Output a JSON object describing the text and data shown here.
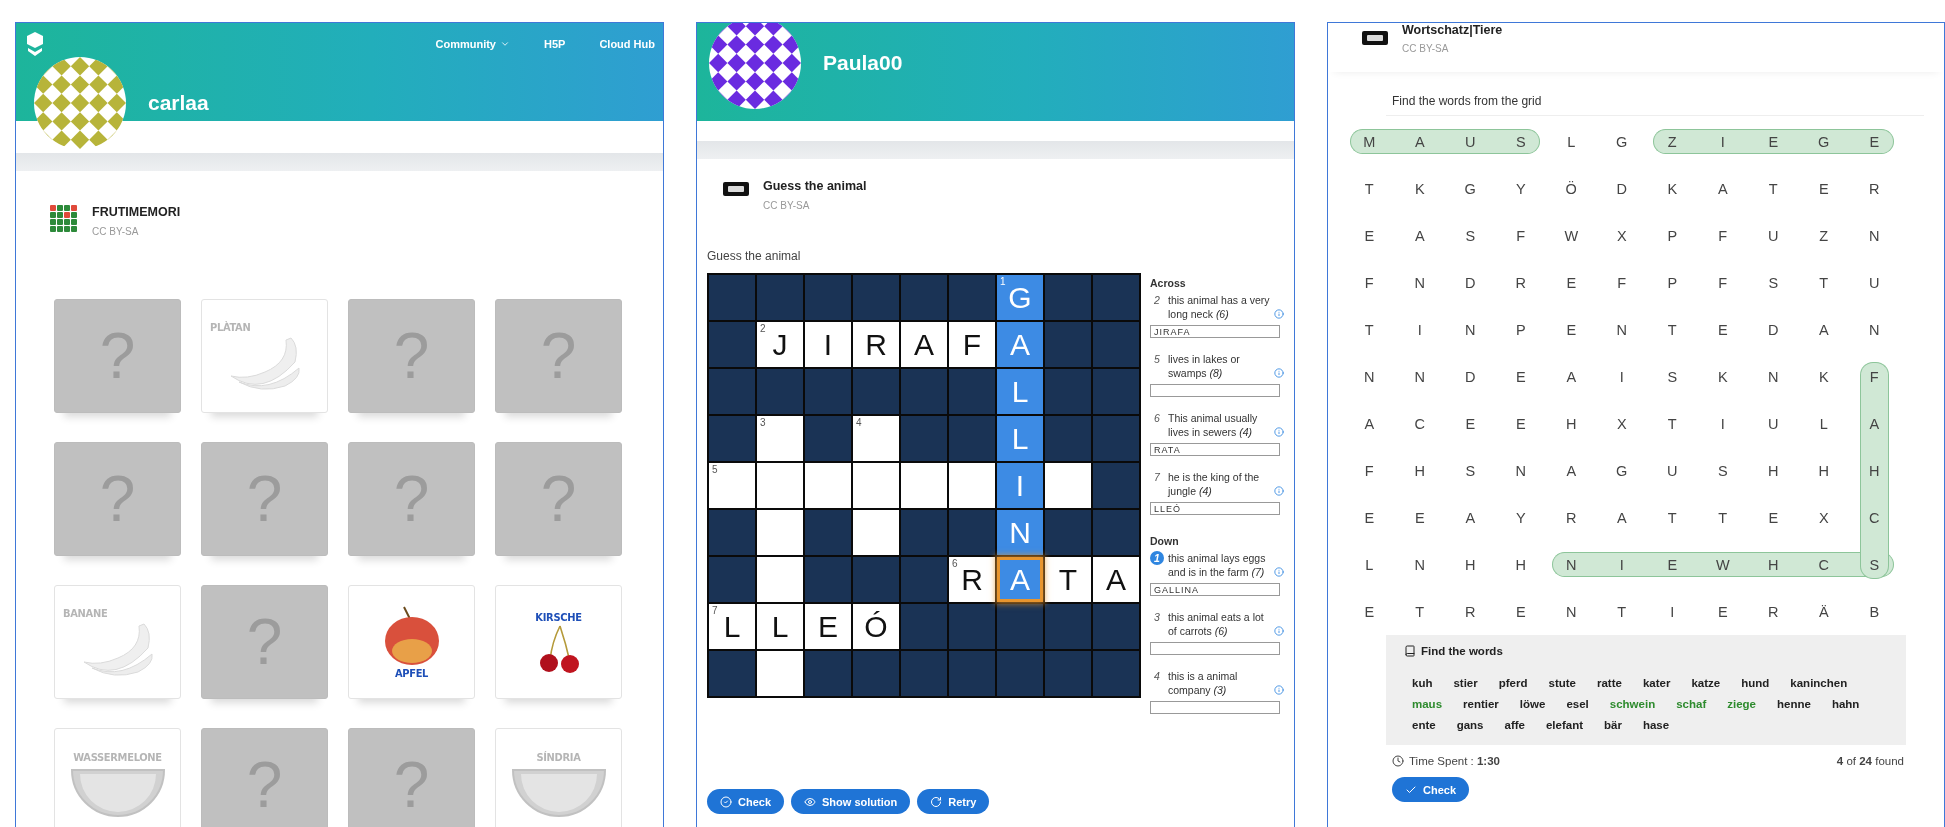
{
  "memory_panel": {
    "nav": [
      {
        "label": "Community",
        "dropdown": true
      },
      {
        "label": "H5P",
        "dropdown": false
      },
      {
        "label": "Cloud Hub",
        "dropdown": false
      }
    ],
    "user": {
      "name": "carlaa"
    },
    "content": {
      "title": "FRUTIMEMORI",
      "license": "CC BY-SA"
    },
    "cards": [
      {
        "kind": "hidden",
        "symbol": "?"
      },
      {
        "kind": "banana",
        "label": "PLÀTAN",
        "matched": true
      },
      {
        "kind": "hidden",
        "symbol": "?"
      },
      {
        "kind": "hidden",
        "symbol": "?"
      },
      {
        "kind": "hidden",
        "symbol": "?"
      },
      {
        "kind": "hidden",
        "symbol": "?"
      },
      {
        "kind": "hidden",
        "symbol": "?"
      },
      {
        "kind": "hidden",
        "symbol": "?"
      },
      {
        "kind": "banana",
        "label": "BANANE",
        "matched": true
      },
      {
        "kind": "hidden",
        "symbol": "?"
      },
      {
        "kind": "apple",
        "label": "APFEL",
        "matched": false
      },
      {
        "kind": "cherry",
        "label": "KIRSCHE",
        "matched": false
      },
      {
        "kind": "melon",
        "label": "WASSERMELONE",
        "matched": true
      },
      {
        "kind": "hidden",
        "symbol": "?"
      },
      {
        "kind": "hidden",
        "symbol": "?"
      },
      {
        "kind": "melon",
        "label": "SÍNDRIA",
        "matched": true
      }
    ]
  },
  "crossword_panel": {
    "user": {
      "name": "Paula00"
    },
    "content": {
      "title": "Guess the animal",
      "license": "CC BY-SA"
    },
    "question": "Guess the animal",
    "grid": [
      {
        "cells": [
          {
            "kind": "block"
          },
          {
            "kind": "block"
          },
          {
            "kind": "block"
          },
          {
            "kind": "block"
          },
          {
            "kind": "block"
          },
          {
            "kind": "block"
          },
          {
            "kind": "open",
            "letter": "G",
            "number": "1",
            "highlighted": true,
            "focused": false
          },
          {
            "kind": "block"
          },
          {
            "kind": "block"
          }
        ]
      },
      {
        "cells": [
          {
            "kind": "block"
          },
          {
            "kind": "open",
            "letter": "J",
            "number": "2",
            "highlighted": false,
            "focused": false
          },
          {
            "kind": "open",
            "letter": "I",
            "highlighted": false,
            "focused": false
          },
          {
            "kind": "open",
            "letter": "R",
            "highlighted": false,
            "focused": false
          },
          {
            "kind": "open",
            "letter": "A",
            "highlighted": false,
            "focused": false
          },
          {
            "kind": "open",
            "letter": "F",
            "highlighted": false,
            "focused": false
          },
          {
            "kind": "open",
            "letter": "A",
            "highlighted": true,
            "focused": false
          },
          {
            "kind": "block"
          },
          {
            "kind": "block"
          }
        ]
      },
      {
        "cells": [
          {
            "kind": "block"
          },
          {
            "kind": "block"
          },
          {
            "kind": "block"
          },
          {
            "kind": "block"
          },
          {
            "kind": "block"
          },
          {
            "kind": "block"
          },
          {
            "kind": "open",
            "letter": "L",
            "highlighted": true,
            "focused": false
          },
          {
            "kind": "block"
          },
          {
            "kind": "block"
          }
        ]
      },
      {
        "cells": [
          {
            "kind": "block"
          },
          {
            "kind": "open",
            "number": "3",
            "highlighted": false,
            "focused": false
          },
          {
            "kind": "block"
          },
          {
            "kind": "open",
            "number": "4",
            "highlighted": false,
            "focused": false
          },
          {
            "kind": "block"
          },
          {
            "kind": "block"
          },
          {
            "kind": "open",
            "letter": "L",
            "highlighted": true,
            "focused": false
          },
          {
            "kind": "block"
          },
          {
            "kind": "block"
          }
        ]
      },
      {
        "cells": [
          {
            "kind": "open",
            "number": "5",
            "highlighted": false,
            "focused": false
          },
          {
            "kind": "open",
            "highlighted": false,
            "focused": false
          },
          {
            "kind": "open",
            "highlighted": false,
            "focused": false
          },
          {
            "kind": "open",
            "highlighted": false,
            "focused": false
          },
          {
            "kind": "open",
            "highlighted": false,
            "focused": false
          },
          {
            "kind": "open",
            "highlighted": false,
            "focused": false
          },
          {
            "kind": "open",
            "letter": "I",
            "highlighted": true,
            "focused": false
          },
          {
            "kind": "open",
            "highlighted": false,
            "focused": false
          },
          {
            "kind": "block"
          }
        ]
      },
      {
        "cells": [
          {
            "kind": "block"
          },
          {
            "kind": "open",
            "highlighted": false,
            "focused": false
          },
          {
            "kind": "block"
          },
          {
            "kind": "open",
            "highlighted": false,
            "focused": false
          },
          {
            "kind": "block"
          },
          {
            "kind": "block"
          },
          {
            "kind": "open",
            "letter": "N",
            "highlighted": true,
            "focused": false
          },
          {
            "kind": "block"
          },
          {
            "kind": "block"
          }
        ]
      },
      {
        "cells": [
          {
            "kind": "block"
          },
          {
            "kind": "open",
            "highlighted": false,
            "focused": false
          },
          {
            "kind": "block"
          },
          {
            "kind": "block"
          },
          {
            "kind": "block"
          },
          {
            "kind": "open",
            "letter": "R",
            "number": "6",
            "highlighted": false,
            "focused": false
          },
          {
            "kind": "open",
            "letter": "A",
            "highlighted": true,
            "focused": true
          },
          {
            "kind": "open",
            "letter": "T",
            "highlighted": false,
            "focused": false
          },
          {
            "kind": "open",
            "letter": "A",
            "highlighted": false,
            "focused": false
          }
        ]
      },
      {
        "cells": [
          {
            "kind": "open",
            "letter": "L",
            "number": "7",
            "highlighted": false,
            "focused": false
          },
          {
            "kind": "open",
            "letter": "L",
            "highlighted": false,
            "focused": false
          },
          {
            "kind": "open",
            "letter": "E",
            "highlighted": false,
            "focused": false
          },
          {
            "kind": "open",
            "letter": "Ó",
            "highlighted": false,
            "focused": false
          },
          {
            "kind": "block"
          },
          {
            "kind": "block"
          },
          {
            "kind": "block"
          },
          {
            "kind": "block"
          },
          {
            "kind": "block"
          }
        ]
      },
      {
        "cells": [
          {
            "kind": "block"
          },
          {
            "kind": "open",
            "highlighted": false,
            "focused": false
          },
          {
            "kind": "block"
          },
          {
            "kind": "block"
          },
          {
            "kind": "block"
          },
          {
            "kind": "block"
          },
          {
            "kind": "block"
          },
          {
            "kind": "block"
          },
          {
            "kind": "block"
          }
        ]
      }
    ],
    "clue_groups": [
      {
        "heading": "Across",
        "clues": [
          {
            "number": "2",
            "text": "this animal has a very long neck  *(6)*",
            "answer": "JIRAFA",
            "selected": false
          },
          {
            "number": "5",
            "text": "lives in lakes or swamps  *(8)*",
            "selected": false
          },
          {
            "number": "6",
            "text": "This animal usually lives in sewers  *(4)*",
            "answer": "RATA",
            "selected": false
          },
          {
            "number": "7",
            "text": "he is the king of the jungle  *(4)*",
            "answer": "LLEÓ",
            "selected": false
          }
        ]
      },
      {
        "heading": "Down",
        "clues": [
          {
            "number": "1",
            "text": "this animal lays eggs and is in the farm  *(7)*",
            "answer": "GALLINA",
            "selected": true
          },
          {
            "number": "3",
            "text": "this animal eats a lot of carrots  *(6)*",
            "selected": false
          },
          {
            "number": "4",
            "text": "this is a animal company  *(3)*",
            "selected": false
          }
        ]
      }
    ],
    "buttons": [
      {
        "label": "Check",
        "kind": "check"
      },
      {
        "label": "Show solution",
        "kind": "solution"
      },
      {
        "label": "Retry",
        "kind": "retry"
      }
    ]
  },
  "wordsearch_panel": {
    "content": {
      "title": "Wortschatz|Tiere",
      "license": "CC BY-SA"
    },
    "instruction": "Find the words from the grid",
    "grid": [
      {
        "cells": [
          {
            "letter": "M",
            "found": true
          },
          {
            "letter": "A",
            "found": true
          },
          {
            "letter": "U",
            "found": true
          },
          {
            "letter": "S",
            "found": true
          },
          {
            "letter": "L",
            "found": false
          },
          {
            "letter": "G",
            "found": false
          },
          {
            "letter": "Z",
            "found": true
          },
          {
            "letter": "I",
            "found": true
          },
          {
            "letter": "E",
            "found": true
          },
          {
            "letter": "G",
            "found": true
          },
          {
            "letter": "E",
            "found": true
          }
        ]
      },
      {
        "cells": [
          {
            "letter": "T",
            "found": false
          },
          {
            "letter": "K",
            "found": false
          },
          {
            "letter": "G",
            "found": false
          },
          {
            "letter": "Y",
            "found": false
          },
          {
            "letter": "Ö",
            "found": false
          },
          {
            "letter": "D",
            "found": false
          },
          {
            "letter": "K",
            "found": false
          },
          {
            "letter": "A",
            "found": false
          },
          {
            "letter": "T",
            "found": false
          },
          {
            "letter": "E",
            "found": false
          },
          {
            "letter": "R",
            "found": false
          }
        ]
      },
      {
        "cells": [
          {
            "letter": "E",
            "found": false
          },
          {
            "letter": "A",
            "found": false
          },
          {
            "letter": "S",
            "found": false
          },
          {
            "letter": "F",
            "found": false
          },
          {
            "letter": "W",
            "found": false
          },
          {
            "letter": "X",
            "found": false
          },
          {
            "letter": "P",
            "found": false
          },
          {
            "letter": "F",
            "found": false
          },
          {
            "letter": "U",
            "found": false
          },
          {
            "letter": "Z",
            "found": false
          },
          {
            "letter": "N",
            "found": false
          }
        ]
      },
      {
        "cells": [
          {
            "letter": "F",
            "found": false
          },
          {
            "letter": "N",
            "found": false
          },
          {
            "letter": "D",
            "found": false
          },
          {
            "letter": "R",
            "found": false
          },
          {
            "letter": "E",
            "found": false
          },
          {
            "letter": "F",
            "found": false
          },
          {
            "letter": "P",
            "found": false
          },
          {
            "letter": "F",
            "found": false
          },
          {
            "letter": "S",
            "found": false
          },
          {
            "letter": "T",
            "found": false
          },
          {
            "letter": "U",
            "found": false
          }
        ]
      },
      {
        "cells": [
          {
            "letter": "T",
            "found": false
          },
          {
            "letter": "I",
            "found": false
          },
          {
            "letter": "N",
            "found": false
          },
          {
            "letter": "P",
            "found": false
          },
          {
            "letter": "E",
            "found": false
          },
          {
            "letter": "N",
            "found": false
          },
          {
            "letter": "T",
            "found": false
          },
          {
            "letter": "E",
            "found": false
          },
          {
            "letter": "D",
            "found": false
          },
          {
            "letter": "A",
            "found": false
          },
          {
            "letter": "N",
            "found": false
          }
        ]
      },
      {
        "cells": [
          {
            "letter": "N",
            "found": false
          },
          {
            "letter": "N",
            "found": false
          },
          {
            "letter": "D",
            "found": false
          },
          {
            "letter": "E",
            "found": false
          },
          {
            "letter": "A",
            "found": false
          },
          {
            "letter": "I",
            "found": false
          },
          {
            "letter": "S",
            "found": false
          },
          {
            "letter": "K",
            "found": false
          },
          {
            "letter": "N",
            "found": false
          },
          {
            "letter": "K",
            "found": false
          },
          {
            "letter": "F",
            "found": true
          }
        ]
      },
      {
        "cells": [
          {
            "letter": "A",
            "found": false
          },
          {
            "letter": "C",
            "found": false
          },
          {
            "letter": "E",
            "found": false
          },
          {
            "letter": "E",
            "found": false
          },
          {
            "letter": "H",
            "found": false
          },
          {
            "letter": "X",
            "found": false
          },
          {
            "letter": "T",
            "found": false
          },
          {
            "letter": "I",
            "found": false
          },
          {
            "letter": "U",
            "found": false
          },
          {
            "letter": "L",
            "found": false
          },
          {
            "letter": "A",
            "found": true
          }
        ]
      },
      {
        "cells": [
          {
            "letter": "F",
            "found": false
          },
          {
            "letter": "H",
            "found": false
          },
          {
            "letter": "S",
            "found": false
          },
          {
            "letter": "N",
            "found": false
          },
          {
            "letter": "A",
            "found": false
          },
          {
            "letter": "G",
            "found": false
          },
          {
            "letter": "U",
            "found": false
          },
          {
            "letter": "S",
            "found": false
          },
          {
            "letter": "H",
            "found": false
          },
          {
            "letter": "H",
            "found": false
          },
          {
            "letter": "H",
            "found": true
          }
        ]
      },
      {
        "cells": [
          {
            "letter": "E",
            "found": false
          },
          {
            "letter": "E",
            "found": false
          },
          {
            "letter": "A",
            "found": false
          },
          {
            "letter": "Y",
            "found": false
          },
          {
            "letter": "R",
            "found": false
          },
          {
            "letter": "A",
            "found": false
          },
          {
            "letter": "T",
            "found": false
          },
          {
            "letter": "T",
            "found": false
          },
          {
            "letter": "E",
            "found": false
          },
          {
            "letter": "X",
            "found": false
          },
          {
            "letter": "C",
            "found": true
          }
        ]
      },
      {
        "cells": [
          {
            "letter": "L",
            "found": false
          },
          {
            "letter": "N",
            "found": false
          },
          {
            "letter": "H",
            "found": false
          },
          {
            "letter": "H",
            "found": false
          },
          {
            "letter": "N",
            "found": true
          },
          {
            "letter": "I",
            "found": true
          },
          {
            "letter": "E",
            "found": true
          },
          {
            "letter": "W",
            "found": true
          },
          {
            "letter": "H",
            "found": true
          },
          {
            "letter": "C",
            "found": true
          },
          {
            "letter": "S",
            "found": true
          }
        ]
      },
      {
        "cells": [
          {
            "letter": "E",
            "found": false
          },
          {
            "letter": "T",
            "found": false
          },
          {
            "letter": "R",
            "found": false
          },
          {
            "letter": "E",
            "found": false
          },
          {
            "letter": "N",
            "found": false
          },
          {
            "letter": "T",
            "found": false
          },
          {
            "letter": "I",
            "found": false
          },
          {
            "letter": "E",
            "found": false
          },
          {
            "letter": "R",
            "found": false
          },
          {
            "letter": "Ä",
            "found": false
          },
          {
            "letter": "B",
            "found": false
          }
        ]
      }
    ],
    "word_list": {
      "heading": "Find the words",
      "words": [
        {
          "text": "kuh",
          "found": false
        },
        {
          "text": "stier",
          "found": false
        },
        {
          "text": "pferd",
          "found": false
        },
        {
          "text": "stute",
          "found": false
        },
        {
          "text": "ratte",
          "found": false
        },
        {
          "text": "kater",
          "found": false
        },
        {
          "text": "katze",
          "found": false
        },
        {
          "text": "hund",
          "found": false
        },
        {
          "text": "kaninchen",
          "found": false
        },
        {
          "text": "maus",
          "found": true
        },
        {
          "text": "rentier",
          "found": false
        },
        {
          "text": "löwe",
          "found": false
        },
        {
          "text": "esel",
          "found": false
        },
        {
          "text": "schwein",
          "found": true
        },
        {
          "text": "schaf",
          "found": true
        },
        {
          "text": "ziege",
          "found": true
        },
        {
          "text": "henne",
          "found": false
        },
        {
          "text": "hahn",
          "found": false
        },
        {
          "text": "ente",
          "found": false
        },
        {
          "text": "gans",
          "found": false
        },
        {
          "text": "affe",
          "found": false
        },
        {
          "text": "elefant",
          "found": false
        },
        {
          "text": "bär",
          "found": false
        },
        {
          "text": "hase",
          "found": false
        }
      ]
    },
    "time_spent": "Time Spent : **1:30**",
    "found_count": "**4** of **24** found",
    "buttons": [
      {
        "label": "Check",
        "kind": "check"
      }
    ]
  }
}
